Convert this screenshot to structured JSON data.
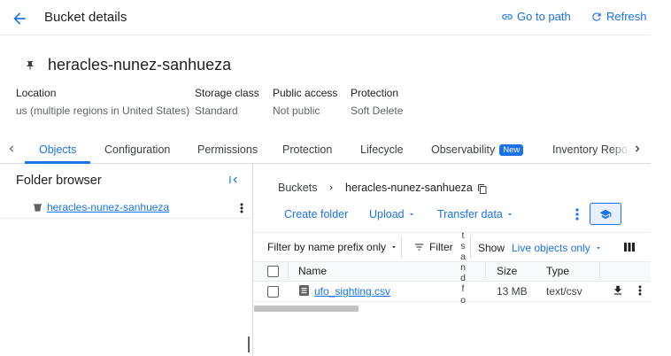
{
  "header": {
    "title": "Bucket details",
    "go_to_path": "Go to path",
    "refresh": "Refresh"
  },
  "bucket": {
    "name": "heracles-nunez-sanhueza",
    "meta": [
      {
        "label": "Location",
        "value": "us (multiple regions in United States)"
      },
      {
        "label": "Storage class",
        "value": "Standard"
      },
      {
        "label": "Public access",
        "value": "Not public"
      },
      {
        "label": "Protection",
        "value": "Soft Delete"
      }
    ]
  },
  "tabs": [
    {
      "label": "Objects",
      "active": true
    },
    {
      "label": "Configuration"
    },
    {
      "label": "Permissions"
    },
    {
      "label": "Protection"
    },
    {
      "label": "Lifecycle"
    },
    {
      "label": "Observability",
      "badge": "New"
    },
    {
      "label": "Inventory Repo"
    }
  ],
  "folder_browser": {
    "title": "Folder browser",
    "item": "heracles-nunez-sanhueza"
  },
  "breadcrumb": {
    "root": "Buckets",
    "separator": "›",
    "current": "heracles-nunez-sanhueza"
  },
  "actions": {
    "create_folder": "Create folder",
    "upload": "Upload",
    "transfer_data": "Transfer data"
  },
  "filters": {
    "prefix": "Filter by name prefix only",
    "filter": "Filter",
    "show_label": "Show",
    "show_value": "Live objects only"
  },
  "table": {
    "columns": [
      "Name",
      "Size",
      "Type"
    ],
    "rows": [
      {
        "name": "ufo_sighting.csv",
        "size": "13 MB",
        "type": "text/csv"
      }
    ]
  },
  "overlay_vertical_text": "tsandfo",
  "colors": {
    "accent": "#1a73e8",
    "text": "#202124",
    "muted": "#5f6368",
    "border": "#dadce0"
  }
}
